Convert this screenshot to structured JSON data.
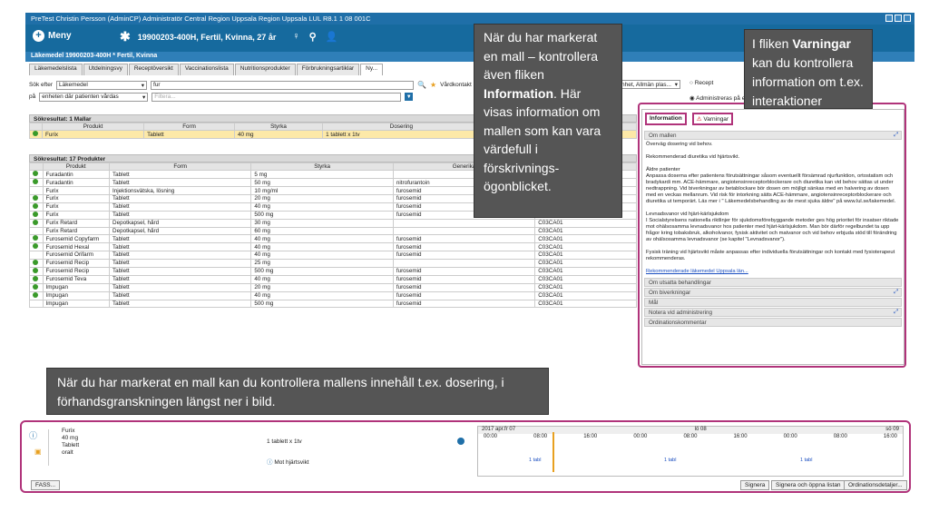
{
  "titlebar": {
    "text": "PreTest Christin Persson (AdminCP) Administratör Central Region Uppsala Region Uppsala LUL R8.1 1 08 001C"
  },
  "header": {
    "menu_label": "Meny",
    "patient": "19900203-400H, Fertil, Kvinna, 27 år"
  },
  "subbar": {
    "text": "Läkemedel 19900203-400H * Fertil, Kvinna"
  },
  "tabs": [
    "Läkemedelslista",
    "Utdelningsvy",
    "Receptöversikt",
    "Vaccinationslista",
    "Nutritionsprodukter",
    "Förbrukningsartiklar",
    "Ny..."
  ],
  "search": {
    "label1": "Sök efter",
    "type_value": "Läkemedel",
    "query": "fur",
    "label2": "på",
    "scope_value": "enheten där patienten vårdas",
    "filter_placeholder": "Filtera...",
    "vardkontakt_label": "Vårdkontakt",
    "vardkontakt_value": "U",
    "unit_value": "nhet, Allmän plas...",
    "recept_label": "Recept",
    "admin_label": "Administreras på e"
  },
  "mallar": {
    "title": "Sökresultat: 1 Mallar",
    "columns": [
      "Produkt",
      "Form",
      "Styrka",
      "Dosering",
      "Ordinations"
    ],
    "rows": [
      [
        "Furix",
        "Tablett",
        "40 mg",
        "1 tablett x 1tv",
        "Mot hjärtsvikt"
      ]
    ]
  },
  "produkter": {
    "title": "Sökresultat: 17 Produkter",
    "columns": [
      "Produkt",
      "Form",
      "Styrka",
      "Generika",
      ""
    ],
    "rows": [
      [
        "Furadantin",
        "Tablett",
        "5 mg",
        "",
        "",
        true
      ],
      [
        "Furadantin",
        "Tablett",
        "50 mg",
        "nitrofurantoin",
        "",
        true
      ],
      [
        "Furix",
        "Injektionsvätska, lösning",
        "10 mg/ml",
        "furosemid",
        "",
        false
      ],
      [
        "Furix",
        "Tablett",
        "20 mg",
        "furosemid",
        "",
        true
      ],
      [
        "Furix",
        "Tablett",
        "40 mg",
        "furosemid",
        "",
        true
      ],
      [
        "Furix",
        "Tablett",
        "500 mg",
        "furosemid",
        "C03CA01",
        true
      ],
      [
        "Furix Retard",
        "Depotkapsel, hård",
        "30 mg",
        "",
        "C03CA01",
        true
      ],
      [
        "Furix Retard",
        "Depotkapsel, hård",
        "60 mg",
        "",
        "C03CA01",
        false
      ],
      [
        "Furosemid Copyfarm",
        "Tablett",
        "40 mg",
        "furosemid",
        "C03CA01",
        true
      ],
      [
        "Furosemid Hexal",
        "Tablett",
        "40 mg",
        "furosemid",
        "C03CA01",
        true
      ],
      [
        "Furosemid Orifarm",
        "Tablett",
        "40 mg",
        "furosemid",
        "C03CA01",
        false
      ],
      [
        "Furosemid Recip",
        "Tablett",
        "25 mg",
        "",
        "C03CA01",
        true
      ],
      [
        "Furosemid Recip",
        "Tablett",
        "500 mg",
        "furosemid",
        "C03CA01",
        true
      ],
      [
        "Furosemid Teva",
        "Tablett",
        "40 mg",
        "furosemid",
        "C03CA01",
        true
      ],
      [
        "Impugan",
        "Tablett",
        "20 mg",
        "furosemid",
        "C03CA01",
        true
      ],
      [
        "Impugan",
        "Tablett",
        "40 mg",
        "furosemid",
        "C03CA01",
        true
      ],
      [
        "Impugan",
        "Tablett",
        "500 mg",
        "furosemid",
        "C03CA01",
        false
      ]
    ]
  },
  "callouts": {
    "mall_info": "När du har markerat en mall – kontrollera även fliken Information. Här visas information om mallen som kan vara värdefull i förskrivnings-ögonblicket.",
    "mall_info_parts": {
      "a": "När du har markerat en mall – kontrollera även fliken ",
      "b": "Information",
      "c": ". Här visas information om mallen som kan vara värdefull i förskrivnings-ögonblicket."
    },
    "varningar_parts": {
      "a": "I fliken ",
      "b": "Varningar",
      "c": " kan du kontrollera information om t.ex. interaktioner"
    },
    "preview": "När du har markerat en mall kan du kontrollera mallens innehåll t.ex. dosering, i förhandsgranskningen längst ner i bild."
  },
  "info": {
    "tab_info": "Information",
    "tab_warn": "Varningar",
    "sections": [
      "Om mallen",
      "Om utsatta behandlingar",
      "Om biverkningar",
      "Mål",
      "Notera vid administrering",
      "Ordinationskommentar"
    ],
    "p1": "Överväg dosering vid behov.",
    "p2": "Rekommenderad diuretika vid hjärtsvikt.",
    "p3": "Äldre patienter\nAnpassa doserna efter patientens förutsättningar såsom eventuellt försämrad njurfunktion, ortostatism och bradykardi mm. ACE-hämmare, angiotensinreceptorblockerare och diuretika kan vid behov sättas ut under nedtrappning. Vid biverkningar av betablockare bör dosen om möjligt sänkas med en halvering av dosen med en veckas mellanrum. Vid risk för intorkning sätts ACE-hämmare, angiotensinreceptorblockerare och diuretika ut temporärt. Läs mer i \" Läkemedelsbehandling av de mest sjuka äldre\" på www.lul.se/lakemedel.",
    "p4": "Levnadsvanor vid hjärt-kärlsjukdom\nI Socialstyrelsens nationella riktlinjer för sjukdomsförebyggande metoder ges hög prioritet för insatser riktade mot ohälsosamma levnadsvanor hos patienter med hjärt-kärlsjukdom. Man bör därför regelbundet ta upp frågor kring tobaksbruk, alkoholvanor, fysisk aktivitet och matvanor och vid behov erbjuda stöd till förändring av ohälsosamma levnadsvanor (se kapitel \"Levnadsvanor\").",
    "p5": "Fysisk träning vid hjärtsvikt måste anpassas efter individuella förutsättningar och kontakt med fysioterapeut rekommenderas.",
    "link": "Rekommenderade läkemedel Uppsala län..."
  },
  "preview": {
    "name": "Furix",
    "strength": "40 mg",
    "form": "Tablett",
    "route": "oralt",
    "dose": "1 tablett x 1tv",
    "indication": "Mot hjärtsvikt",
    "tl_dates": [
      "2017 apr.fr 07",
      "lö 08",
      "sö 09"
    ],
    "tl_times": [
      "00:00",
      "08:00",
      "16:00",
      "00:00",
      "08:00",
      "16:00",
      "00:00",
      "08:00",
      "16:00"
    ],
    "dose_mark": "1 tabl",
    "buttons": {
      "fass": "FASS...",
      "sign": "Signera",
      "sign_open": "Signera och öppna listan",
      "details": "Ordinationsdetaljer..."
    }
  }
}
